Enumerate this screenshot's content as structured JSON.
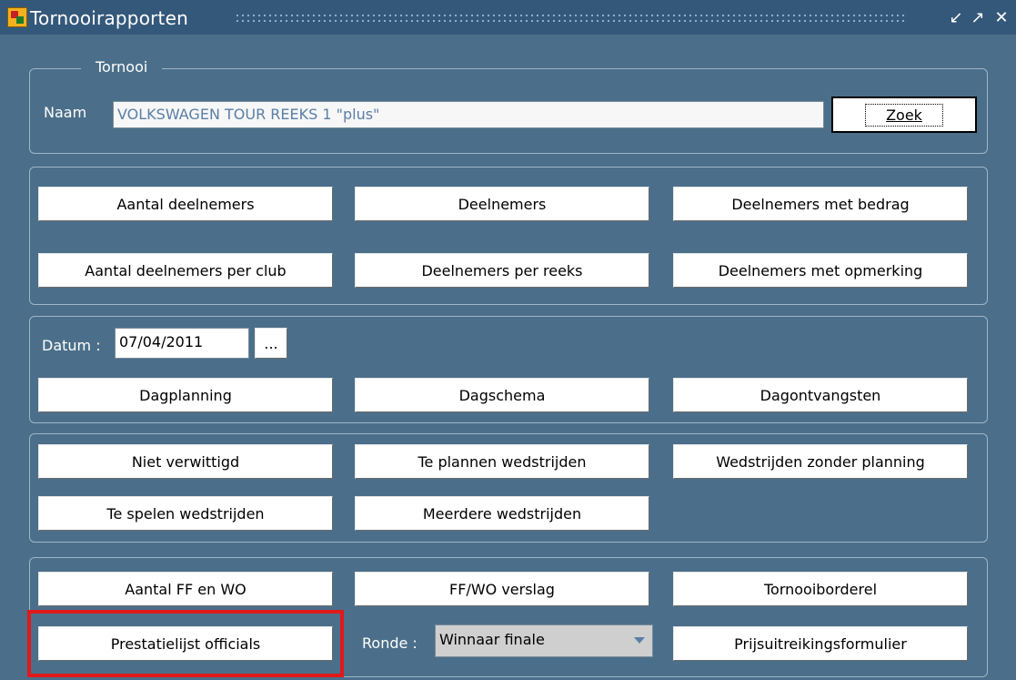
{
  "window": {
    "title": "Tornooirapporten",
    "min_icon": "minimize-icon",
    "max_icon": "maximize-icon",
    "close_icon": "close-icon"
  },
  "tornooi": {
    "legend": "Tornooi",
    "naam_label": "Naam",
    "naam_value": "VOLKSWAGEN TOUR REEKS 1 \"plus\"",
    "zoek_label": "Zoek"
  },
  "deelnemers": {
    "buttons": [
      "Aantal deelnemers",
      "Deelnemers",
      "Deelnemers met bedrag",
      "Aantal deelnemers per club",
      "Deelnemers per reeks",
      "Deelnemers met opmerking"
    ]
  },
  "datum": {
    "label": "Datum :",
    "value": "07/04/2011",
    "picker_label": "...",
    "buttons": [
      "Dagplanning",
      "Dagschema",
      "Dagontvangsten"
    ]
  },
  "wedstrijden": {
    "buttons": [
      "Niet verwittigd",
      "Te plannen wedstrijden",
      "Wedstrijden zonder planning",
      "Te spelen wedstrijden",
      "Meerdere wedstrijden"
    ]
  },
  "overige": {
    "buttons": [
      "Aantal FF en WO",
      "FF/WO verslag",
      "Tornooiborderel",
      "Prestatielijst officials",
      "Prijsuitreikingsformulier"
    ],
    "ronde_label": "Ronde :",
    "ronde_value": "Winnaar finale"
  },
  "colors": {
    "background": "#4b6f8a",
    "titlebar": "#34587a",
    "highlight": "#e0191b",
    "input_text": "#5a7fa6"
  }
}
